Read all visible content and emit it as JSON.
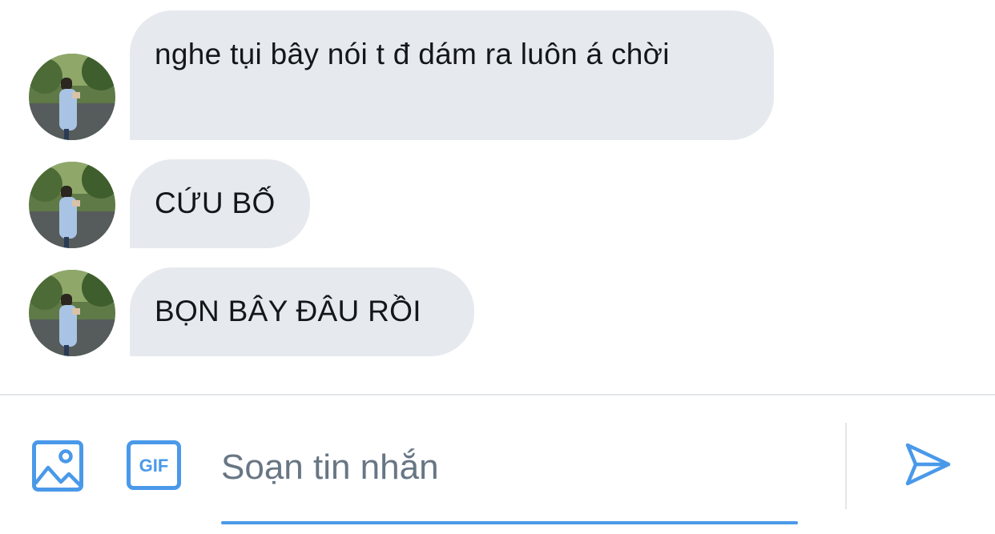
{
  "conversation": {
    "messages": [
      {
        "text": "nghe tụi bây nói t đ dám ra luôn á chời",
        "avatar": "user-avatar-photo"
      },
      {
        "text": "CỨU BỐ",
        "avatar": "user-avatar-photo"
      },
      {
        "text": "BỌN BÂY ĐÂU RỒI",
        "avatar": "user-avatar-photo"
      }
    ]
  },
  "composer": {
    "placeholder": "Soạn tin nhắn",
    "gif_label": "GIF",
    "icons": [
      "image-icon",
      "gif-icon",
      "send-icon"
    ]
  },
  "colors": {
    "accent": "#4a99e9",
    "bubble_bg": "#e6e9ee",
    "text": "#14171a",
    "placeholder": "#687684"
  }
}
